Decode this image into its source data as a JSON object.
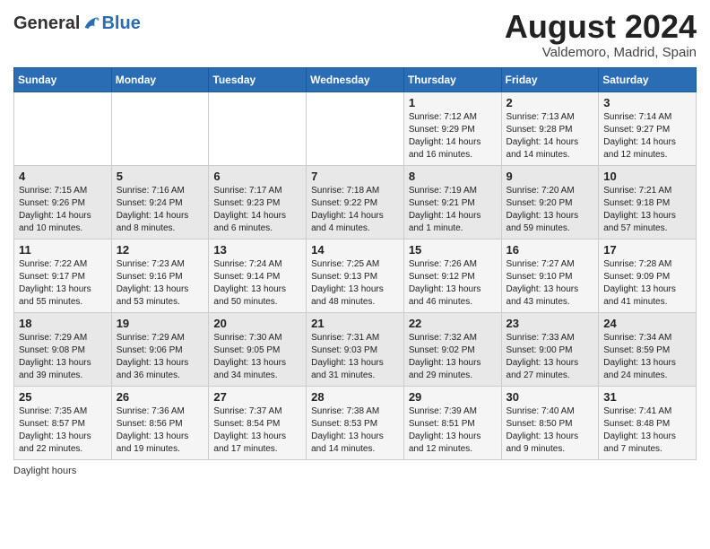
{
  "header": {
    "logo_general": "General",
    "logo_blue": "Blue",
    "month_year": "August 2024",
    "location": "Valdemoro, Madrid, Spain"
  },
  "calendar": {
    "days_of_week": [
      "Sunday",
      "Monday",
      "Tuesday",
      "Wednesday",
      "Thursday",
      "Friday",
      "Saturday"
    ],
    "weeks": [
      [
        {
          "day": "",
          "info": ""
        },
        {
          "day": "",
          "info": ""
        },
        {
          "day": "",
          "info": ""
        },
        {
          "day": "",
          "info": ""
        },
        {
          "day": "1",
          "info": "Sunrise: 7:12 AM\nSunset: 9:29 PM\nDaylight: 14 hours and 16 minutes."
        },
        {
          "day": "2",
          "info": "Sunrise: 7:13 AM\nSunset: 9:28 PM\nDaylight: 14 hours and 14 minutes."
        },
        {
          "day": "3",
          "info": "Sunrise: 7:14 AM\nSunset: 9:27 PM\nDaylight: 14 hours and 12 minutes."
        }
      ],
      [
        {
          "day": "4",
          "info": "Sunrise: 7:15 AM\nSunset: 9:26 PM\nDaylight: 14 hours and 10 minutes."
        },
        {
          "day": "5",
          "info": "Sunrise: 7:16 AM\nSunset: 9:24 PM\nDaylight: 14 hours and 8 minutes."
        },
        {
          "day": "6",
          "info": "Sunrise: 7:17 AM\nSunset: 9:23 PM\nDaylight: 14 hours and 6 minutes."
        },
        {
          "day": "7",
          "info": "Sunrise: 7:18 AM\nSunset: 9:22 PM\nDaylight: 14 hours and 4 minutes."
        },
        {
          "day": "8",
          "info": "Sunrise: 7:19 AM\nSunset: 9:21 PM\nDaylight: 14 hours and 1 minute."
        },
        {
          "day": "9",
          "info": "Sunrise: 7:20 AM\nSunset: 9:20 PM\nDaylight: 13 hours and 59 minutes."
        },
        {
          "day": "10",
          "info": "Sunrise: 7:21 AM\nSunset: 9:18 PM\nDaylight: 13 hours and 57 minutes."
        }
      ],
      [
        {
          "day": "11",
          "info": "Sunrise: 7:22 AM\nSunset: 9:17 PM\nDaylight: 13 hours and 55 minutes."
        },
        {
          "day": "12",
          "info": "Sunrise: 7:23 AM\nSunset: 9:16 PM\nDaylight: 13 hours and 53 minutes."
        },
        {
          "day": "13",
          "info": "Sunrise: 7:24 AM\nSunset: 9:14 PM\nDaylight: 13 hours and 50 minutes."
        },
        {
          "day": "14",
          "info": "Sunrise: 7:25 AM\nSunset: 9:13 PM\nDaylight: 13 hours and 48 minutes."
        },
        {
          "day": "15",
          "info": "Sunrise: 7:26 AM\nSunset: 9:12 PM\nDaylight: 13 hours and 46 minutes."
        },
        {
          "day": "16",
          "info": "Sunrise: 7:27 AM\nSunset: 9:10 PM\nDaylight: 13 hours and 43 minutes."
        },
        {
          "day": "17",
          "info": "Sunrise: 7:28 AM\nSunset: 9:09 PM\nDaylight: 13 hours and 41 minutes."
        }
      ],
      [
        {
          "day": "18",
          "info": "Sunrise: 7:29 AM\nSunset: 9:08 PM\nDaylight: 13 hours and 39 minutes."
        },
        {
          "day": "19",
          "info": "Sunrise: 7:29 AM\nSunset: 9:06 PM\nDaylight: 13 hours and 36 minutes."
        },
        {
          "day": "20",
          "info": "Sunrise: 7:30 AM\nSunset: 9:05 PM\nDaylight: 13 hours and 34 minutes."
        },
        {
          "day": "21",
          "info": "Sunrise: 7:31 AM\nSunset: 9:03 PM\nDaylight: 13 hours and 31 minutes."
        },
        {
          "day": "22",
          "info": "Sunrise: 7:32 AM\nSunset: 9:02 PM\nDaylight: 13 hours and 29 minutes."
        },
        {
          "day": "23",
          "info": "Sunrise: 7:33 AM\nSunset: 9:00 PM\nDaylight: 13 hours and 27 minutes."
        },
        {
          "day": "24",
          "info": "Sunrise: 7:34 AM\nSunset: 8:59 PM\nDaylight: 13 hours and 24 minutes."
        }
      ],
      [
        {
          "day": "25",
          "info": "Sunrise: 7:35 AM\nSunset: 8:57 PM\nDaylight: 13 hours and 22 minutes."
        },
        {
          "day": "26",
          "info": "Sunrise: 7:36 AM\nSunset: 8:56 PM\nDaylight: 13 hours and 19 minutes."
        },
        {
          "day": "27",
          "info": "Sunrise: 7:37 AM\nSunset: 8:54 PM\nDaylight: 13 hours and 17 minutes."
        },
        {
          "day": "28",
          "info": "Sunrise: 7:38 AM\nSunset: 8:53 PM\nDaylight: 13 hours and 14 minutes."
        },
        {
          "day": "29",
          "info": "Sunrise: 7:39 AM\nSunset: 8:51 PM\nDaylight: 13 hours and 12 minutes."
        },
        {
          "day": "30",
          "info": "Sunrise: 7:40 AM\nSunset: 8:50 PM\nDaylight: 13 hours and 9 minutes."
        },
        {
          "day": "31",
          "info": "Sunrise: 7:41 AM\nSunset: 8:48 PM\nDaylight: 13 hours and 7 minutes."
        }
      ]
    ]
  },
  "footer": {
    "daylight_label": "Daylight hours"
  }
}
